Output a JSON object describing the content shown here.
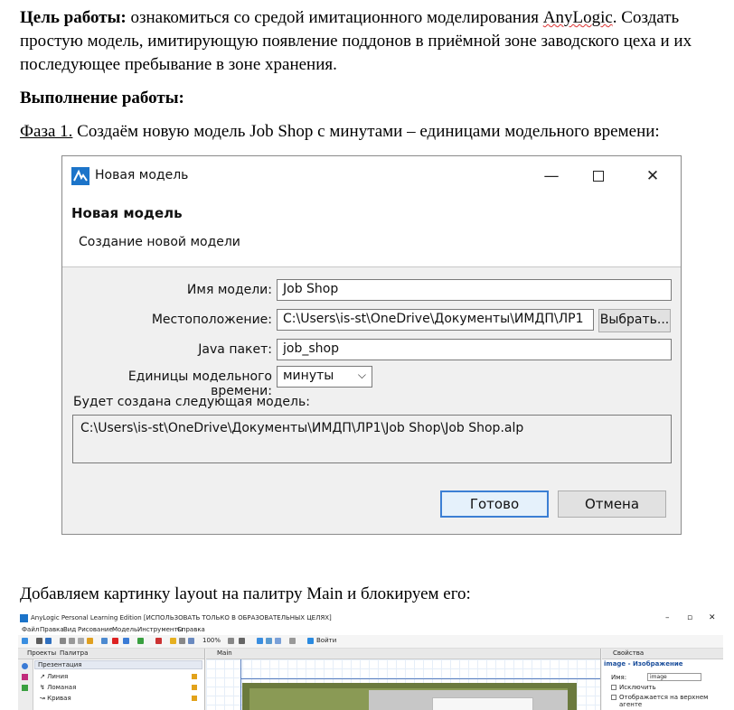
{
  "doc": {
    "goal_label": "Цель работы:",
    "goal_text_pre": " ознакомиться со средой имитационного моделирования ",
    "goal_anylogic": "AnyLogic",
    "goal_text_post": ". Создать простую модель, имитирующую появление поддонов в приёмной зоне заводского цеха и их последующее пребывание в зоне хранения.",
    "execution_heading": "Выполнение работы:",
    "phase_label": "Фаза 1.",
    "phase_text": " Создаём новую модель Job Shop с минутами – единицами модельного времени:",
    "add_image_text": "Добавляем картинку layout на палитру Main и блокируем его:"
  },
  "dialog": {
    "window_title": "Новая модель",
    "header_title": "Новая модель",
    "header_subtitle": "Создание новой модели",
    "model_name_label": "Имя модели:",
    "model_name_value": "Job Shop",
    "location_label": "Местоположение:",
    "location_value": "C:\\Users\\is-st\\OneDrive\\Документы\\ИМДП\\ЛР1",
    "browse_label": "Выбрать...",
    "java_package_label": "Java пакет:",
    "java_package_value": "job_shop",
    "time_units_label": "Единицы модельного времени:",
    "time_units_value": "минуты",
    "preview_label": "Будет создана следующая модель:",
    "preview_value": "C:\\Users\\is-st\\OneDrive\\Документы\\ИМДП\\ЛР1\\Job Shop\\Job Shop.alp",
    "ok_label": "Готово",
    "cancel_label": "Отмена"
  },
  "ide": {
    "window_title": "AnyLogic Personal Learning Edition [ИСПОЛЬЗОВАТЬ ТОЛЬКО В ОБРАЗОВАТЕЛЬНЫХ ЦЕЛЯХ]",
    "menu": [
      "Файл",
      "Правка",
      "Вид",
      "Рисование",
      "Модель",
      "Инструменты",
      "Справка"
    ],
    "zoom": "100%",
    "signin": "Войти",
    "tabs_left": [
      "Проекты",
      "Палитра"
    ],
    "palette_section": "Презентация",
    "palette_items": [
      "Линия",
      "Ломаная",
      "Кривая"
    ],
    "canvas_tab": "Main",
    "props_tab": "Свойства",
    "props_title": "image - Изображение",
    "name_label": "Имя:",
    "name_value": "image",
    "check_exclude": "Исключить",
    "check_show_on_top": "Отображается на верхнем агенте"
  }
}
